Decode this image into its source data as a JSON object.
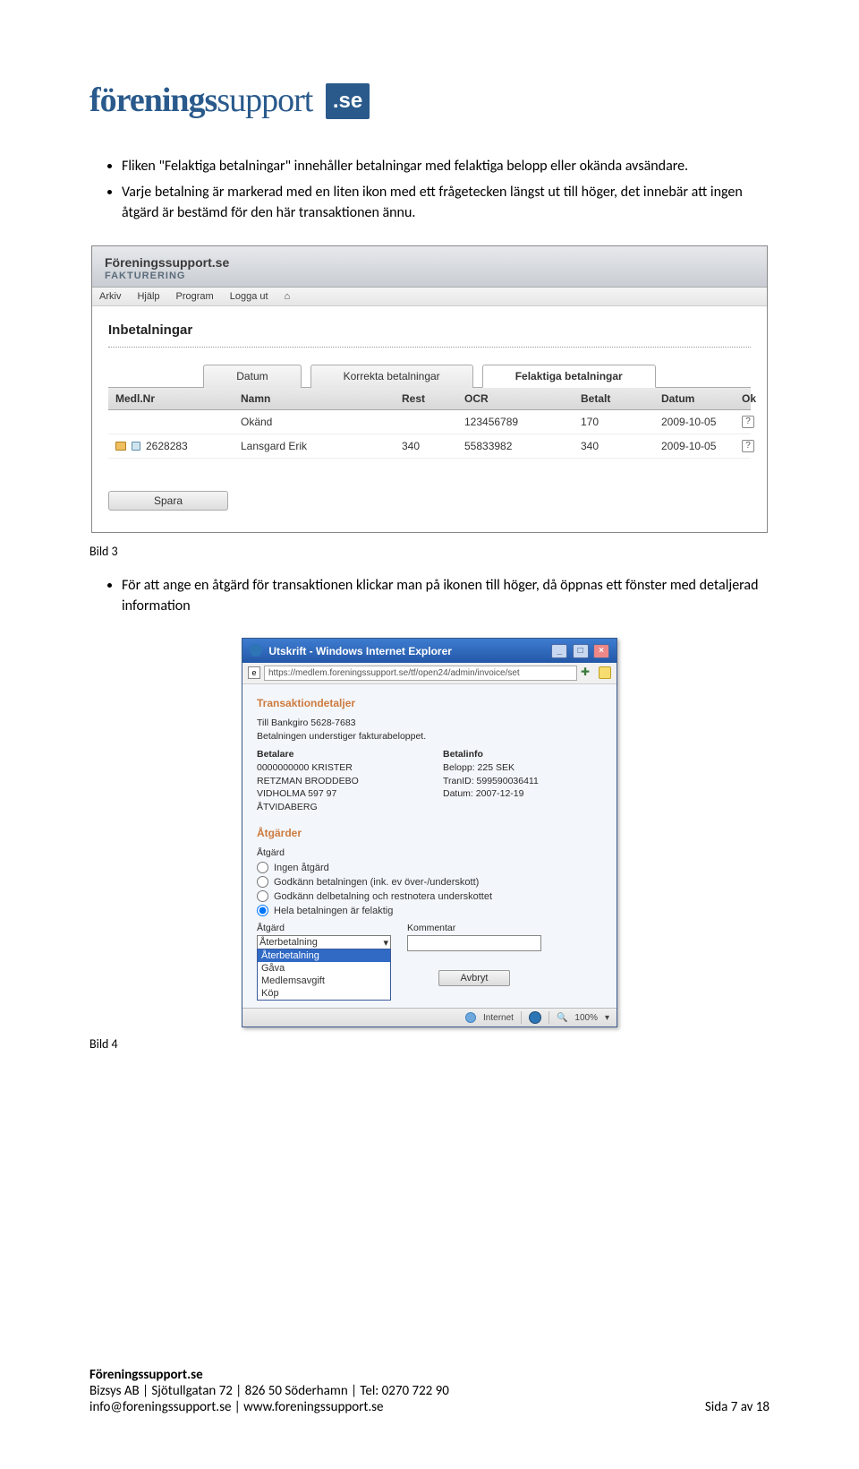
{
  "logo": {
    "word1": "förenings",
    "word2": "support",
    "badge": ".se"
  },
  "bullets_top": [
    "Fliken \"Felaktiga betalningar\" innehåller betalningar med felaktiga belopp eller okända avsändare.",
    "Varje betalning är markerad med en liten ikon med ett frågetecken längst ut till höger, det innebär att ingen åtgärd är bestämd för den här transaktionen ännu."
  ],
  "caption_a": "Bild 3",
  "bullets_mid": [
    "För att ange en åtgärd för transaktionen klickar man på ikonen till höger, då öppnas ett fönster med detaljerad information"
  ],
  "caption_b": "Bild 4",
  "win1": {
    "brand": "Föreningssupport.se",
    "sub": "FAKTURERING",
    "menu": [
      "Arkiv",
      "Hjälp",
      "Program",
      "Logga ut"
    ],
    "title": "Inbetalningar",
    "tabs": [
      "Datum",
      "Korrekta betalningar",
      "Felaktiga betalningar"
    ],
    "active_tab": 2,
    "headers": [
      "Medl.Nr",
      "Namn",
      "Rest",
      "OCR",
      "Betalt",
      "Datum",
      "Ok"
    ],
    "rows": [
      {
        "medlnr": "",
        "namn": "Okänd",
        "rest": "",
        "ocr": "123456789",
        "betalt": "170",
        "datum": "2009-10-05"
      },
      {
        "medlnr": "2628283",
        "namn": "Lansgard Erik",
        "rest": "340",
        "ocr": "55833982",
        "betalt": "340",
        "datum": "2009-10-05"
      }
    ],
    "save": "Spara"
  },
  "win2": {
    "title": "Utskrift - Windows Internet Explorer",
    "url": "https://medlem.foreningssupport.se/tf/open24/admin/invoice/set",
    "section1": "Transaktiondetaljer",
    "bg_line": "Till Bankgiro 5628-7683",
    "under_line": "Betalningen understiger fakturabeloppet.",
    "betalare_h": "Betalare",
    "betalinfo_h": "Betalinfo",
    "betalare": [
      "0000000000 KRISTER",
      "RETZMAN BRODDEBO",
      "VIDHOLMA 597 97",
      "ÅTVIDABERG"
    ],
    "betalinfo": [
      "Belopp: 225 SEK",
      "TranID: 599590036411",
      "Datum: 2007-12-19"
    ],
    "section2": "Åtgärder",
    "atgard_label": "Åtgärd",
    "radios": [
      {
        "label": "Ingen åtgärd",
        "checked": false
      },
      {
        "label": "Godkänn betalningen (ink. ev över-/underskott)",
        "checked": false
      },
      {
        "label": "Godkänn delbetalning och restnotera underskottet",
        "checked": false
      },
      {
        "label": "Hela betalningen är felaktig",
        "checked": true
      }
    ],
    "dd_label": "Åtgärd",
    "komm_label": "Kommentar",
    "dd_selected": "Återbetalning",
    "dd_options": [
      "Återbetalning",
      "Gåva",
      "Medlemsavgift",
      "Köp"
    ],
    "avbryt": "Avbryt",
    "status_net": "Internet",
    "status_zoom": "100%"
  },
  "footer": {
    "name": "Föreningssupport.se",
    "line2": "Bizsys AB   |   Sjötullgatan 72   |   826 50 Söderhamn   |   Tel: 0270 722 90",
    "line3_left": "info@foreningssupport.se   |   www.foreningssupport.se",
    "line3_right": "Sida 7 av 18"
  }
}
